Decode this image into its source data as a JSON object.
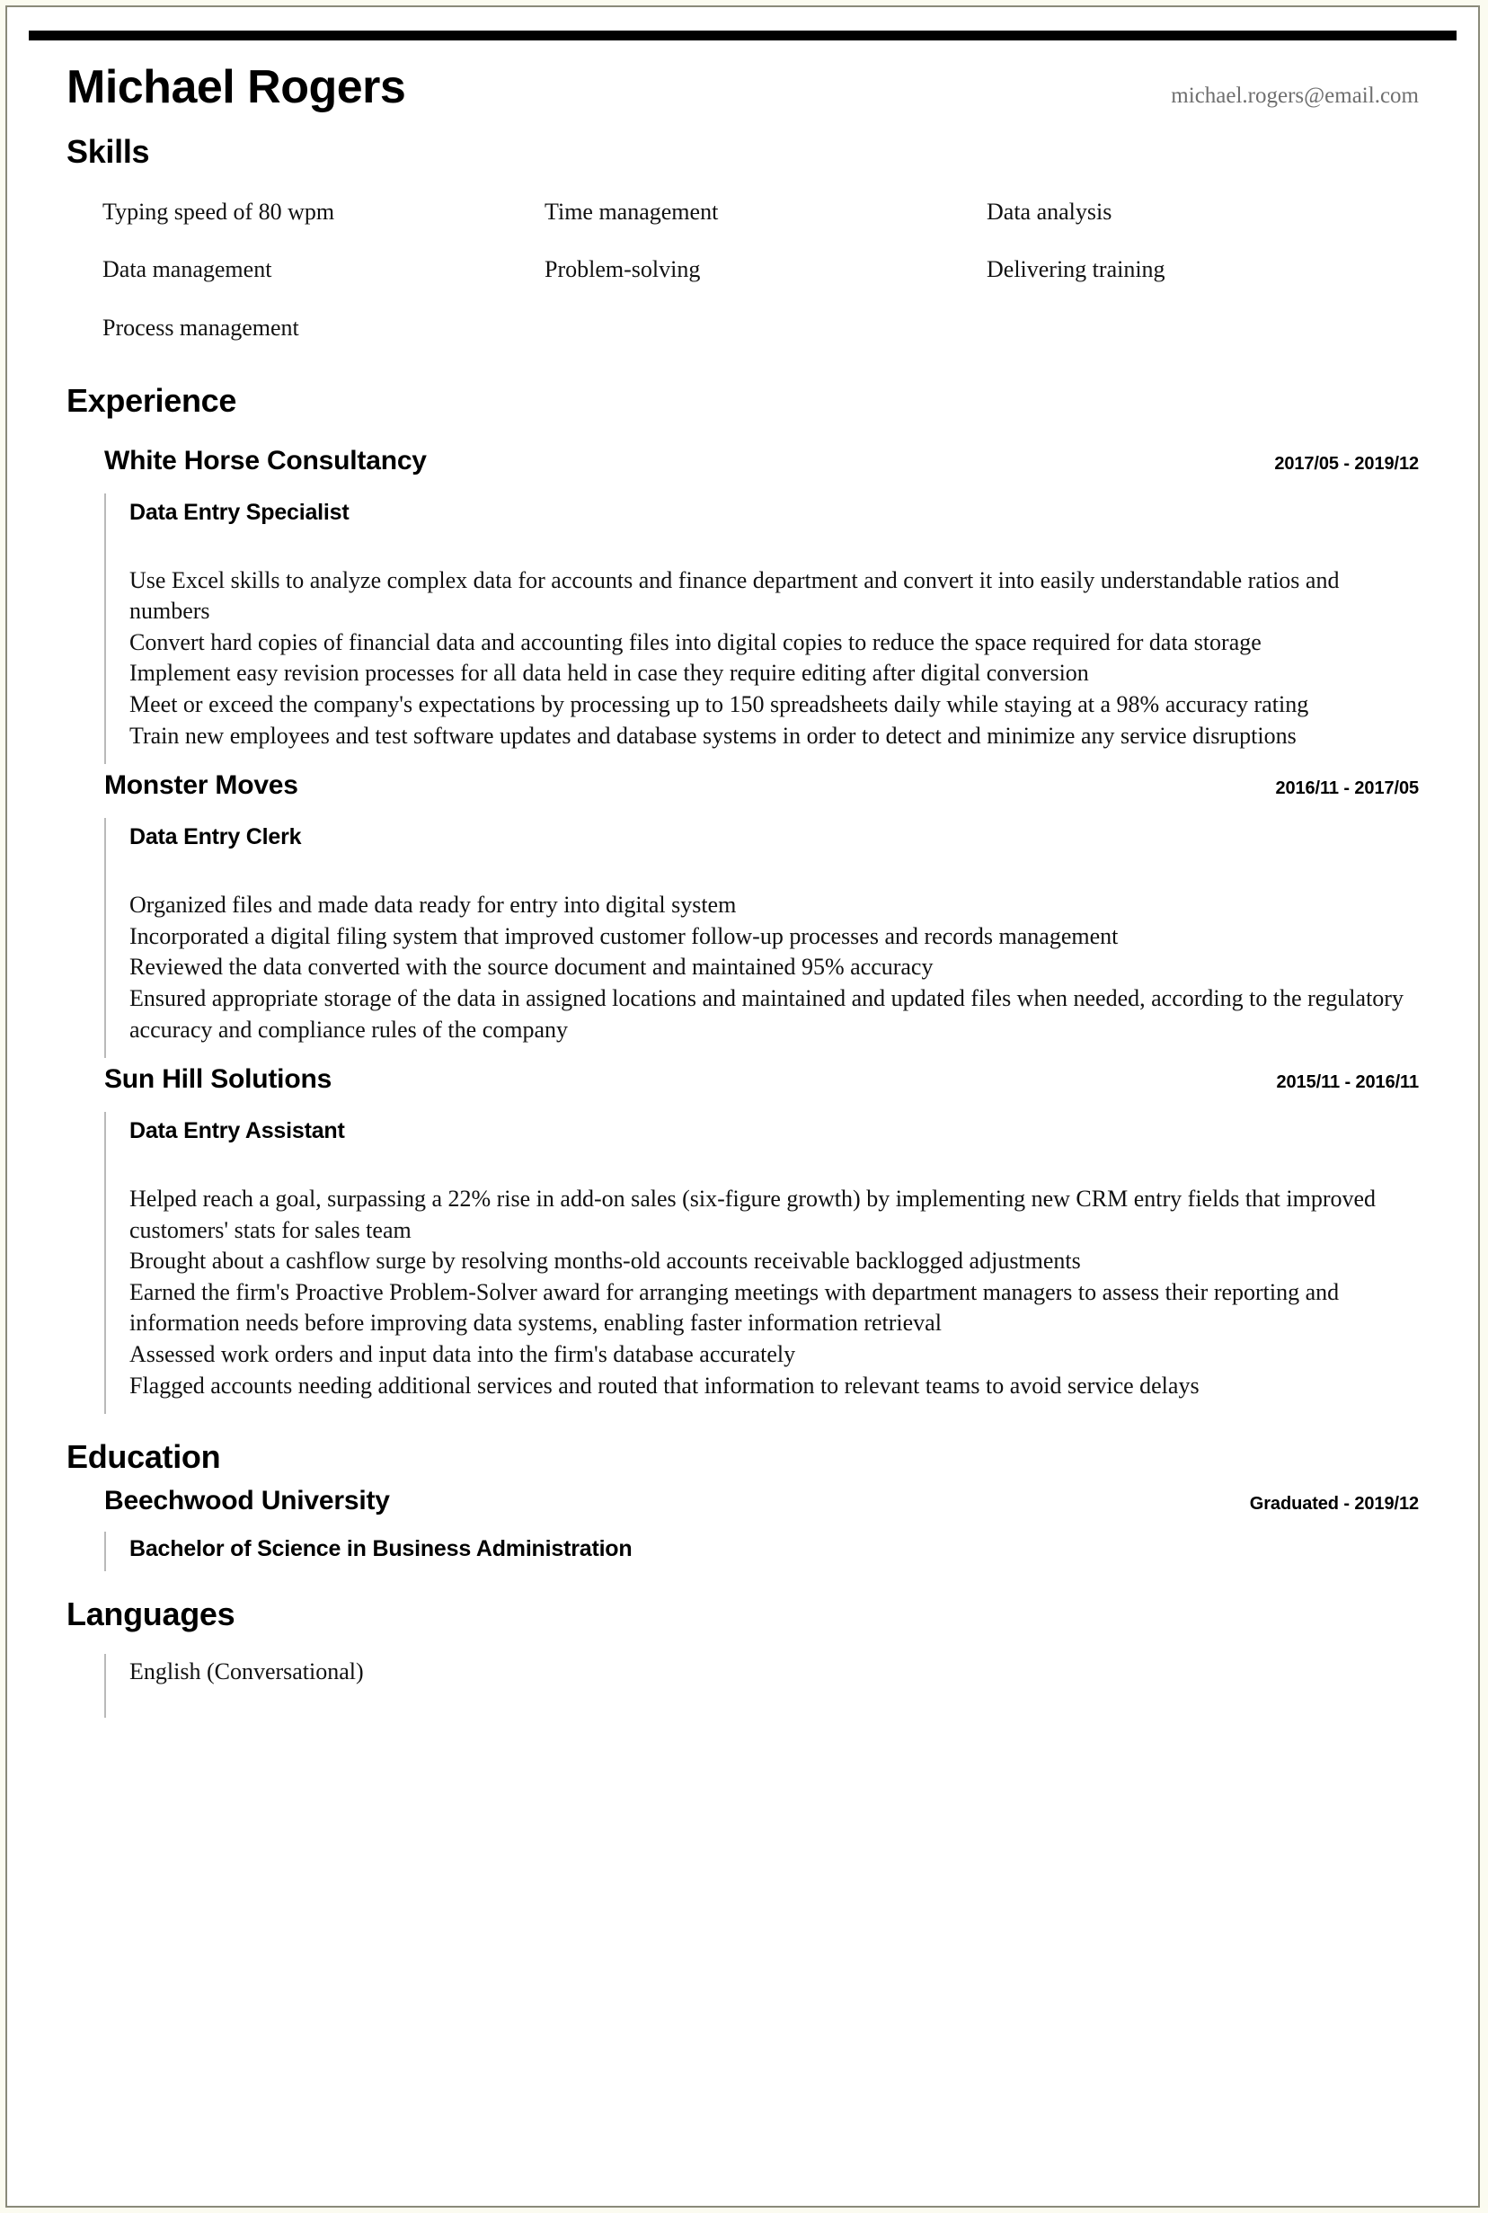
{
  "document_type": "resume",
  "colors": {
    "page_background": "#ffffff",
    "outer_background": "#fbfbf0",
    "page_border": "#8a8a7a",
    "top_rule": "#000000",
    "text": "#111111",
    "muted_text": "#6f6f6f",
    "accent_divider": "#b9b9b9"
  },
  "header": {
    "name": "Michael Rogers",
    "email": "michael.rogers@email.com"
  },
  "sections": {
    "skills": {
      "heading": "Skills",
      "items": [
        "Typing speed of 80 wpm",
        "Time management",
        "Data analysis",
        "Data management",
        "Problem-solving",
        "Delivering training",
        "Process management"
      ]
    },
    "experience": {
      "heading": "Experience",
      "entries": [
        {
          "organization": "White Horse Consultancy",
          "dates": "2017/05 - 2019/12",
          "role": "Data Entry Specialist",
          "duties": [
            "Use Excel skills to analyze complex data for accounts and finance department and convert it into easily understandable ratios and numbers",
            "Convert hard copies of financial data and accounting files into digital copies to reduce the space required for data storage",
            "Implement easy revision processes for all data held in case they require editing after digital conversion",
            "Meet or exceed the company's expectations by processing up to 150 spreadsheets daily while staying at a 98% accuracy rating",
            "Train new employees and test software updates and database systems in order to detect and minimize any service disruptions"
          ]
        },
        {
          "organization": "Monster Moves",
          "dates": "2016/11 - 2017/05",
          "role": "Data Entry Clerk",
          "duties": [
            "Organized files and made data ready for entry into digital system",
            "Incorporated a digital filing system that improved customer follow-up processes and records management",
            "Reviewed the data converted with the source document and maintained 95% accuracy",
            "Ensured appropriate storage of the data in assigned locations and maintained and updated files when needed, according to the regulatory accuracy and compliance rules of the company"
          ]
        },
        {
          "organization": "Sun Hill Solutions",
          "dates": "2015/11 - 2016/11",
          "role": "Data Entry Assistant",
          "duties": [
            "Helped reach a goal, surpassing a 22% rise in add-on sales (six-figure growth) by implementing new CRM entry fields that improved customers' stats for sales team",
            "Brought about a cashflow surge by resolving months-old accounts receivable backlogged adjustments",
            "Earned the firm's Proactive Problem-Solver award for arranging meetings with department managers to assess their reporting and information needs before improving data systems, enabling faster information retrieval",
            "Assessed work orders and input data into the firm's database accurately",
            "Flagged accounts needing additional services and routed that information to relevant teams to avoid service delays"
          ]
        }
      ]
    },
    "education": {
      "heading": "Education",
      "entries": [
        {
          "institution": "Beechwood University",
          "dates": "Graduated - 2019/12",
          "degree": "Bachelor of Science in Business Administration"
        }
      ]
    },
    "languages": {
      "heading": "Languages",
      "items": [
        "English (Conversational)"
      ]
    }
  }
}
